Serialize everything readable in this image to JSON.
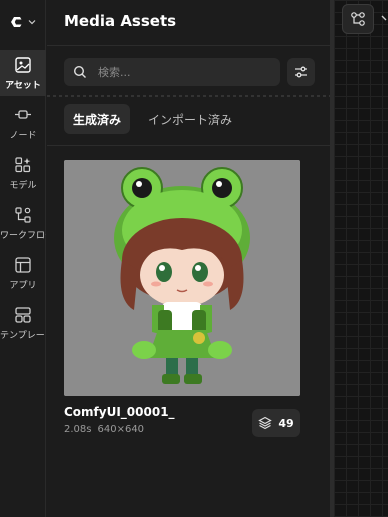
{
  "sidebar": {
    "items": [
      {
        "label": "アセット",
        "icon": "image-icon",
        "active": true
      },
      {
        "label": "ノード",
        "icon": "node-icon",
        "active": false
      },
      {
        "label": "モデル",
        "icon": "model-icon",
        "active": false
      },
      {
        "label": "ワークフロー",
        "icon": "workflow-icon",
        "active": false
      },
      {
        "label": "アプリ",
        "icon": "app-icon",
        "active": false
      },
      {
        "label": "テンプレート",
        "icon": "template-icon",
        "active": false
      }
    ]
  },
  "panel": {
    "title": "Media Assets",
    "search_placeholder": "検索...",
    "tabs": [
      {
        "label": "生成済み",
        "active": true
      },
      {
        "label": "インポート済み",
        "active": false
      }
    ],
    "asset": {
      "name": "ComfyUI_00001_",
      "duration": "2.08s",
      "resolution": "640×640",
      "count": "49"
    }
  },
  "colors": {
    "background": "#1c1c1c",
    "frog_green": "#7bd24a",
    "hair_brown": "#7a3b2a"
  }
}
